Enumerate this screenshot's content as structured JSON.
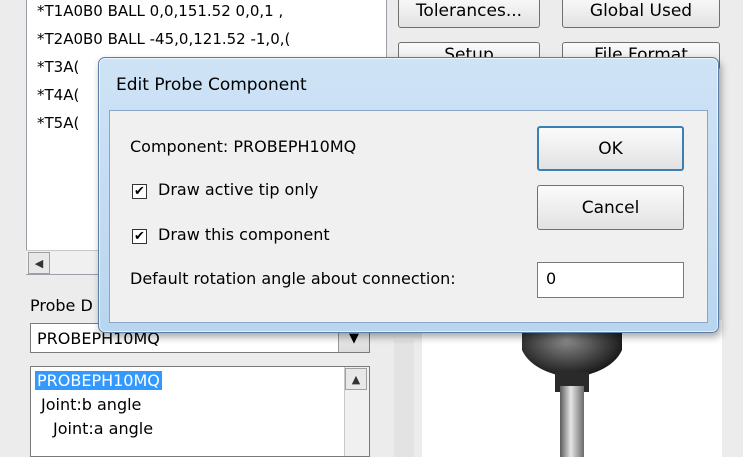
{
  "background_window": {
    "list_rows": [
      "*T1A0B0  BALL 0,0,151.52  0,0,1 ,",
      "*T2A0B0  BALL -45,0,121.52 -1,0,(",
      "*T3A(",
      "*T4A(",
      "*T5A("
    ],
    "top_buttons": [
      "Tolerances...",
      "Global Used"
    ],
    "second_row_buttons": [
      "Setup",
      "File Format"
    ],
    "hscroll_left_arrow": "◀",
    "probe_label": "Probe D",
    "probe_combo_value": "PROBEPH10MQ",
    "combo_arrow": "▼",
    "tree_items": [
      {
        "label": "PROBEPH10MQ",
        "selected": true
      },
      {
        "label": "Joint:b angle",
        "selected": false
      },
      {
        "label": "Joint:a angle",
        "selected": false
      }
    ],
    "tree_scroll_up": "▲"
  },
  "dialog": {
    "title": "Edit Probe Component",
    "component_label": "Component: PROBEPH10MQ",
    "checkbox_active_tip": {
      "label": "Draw active tip only",
      "checked": true
    },
    "checkbox_this_component": {
      "label": "Draw this component",
      "checked": true
    },
    "rotation_label": "Default rotation angle about connection:",
    "rotation_value": "0",
    "ok_button": "OK",
    "cancel_button": "Cancel",
    "check_glyph": "✔"
  },
  "colors": {
    "selection": "#3399ff",
    "dialog_frame": "#b9d5ef"
  }
}
